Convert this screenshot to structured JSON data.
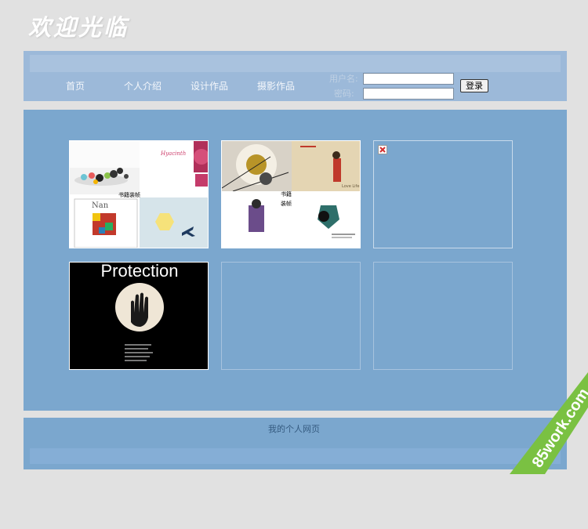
{
  "header": {
    "welcome": "欢迎光临"
  },
  "nav": {
    "items": [
      {
        "label": "首页"
      },
      {
        "label": "个人介绍"
      },
      {
        "label": "设计作品"
      },
      {
        "label": "摄影作品"
      }
    ]
  },
  "login": {
    "username_label": "用户名:",
    "password_label": "密码:",
    "username_value": "",
    "password_value": "",
    "button_label": "登录"
  },
  "gallery": {
    "card1": {
      "caption": "书籍装帧",
      "title": "Hyacinth",
      "name": "Nan"
    },
    "card2": {
      "caption": "书籍装帧",
      "side": "Love Life"
    },
    "card4": {
      "title": "Protection"
    }
  },
  "footer": {
    "text": "我的个人网页"
  },
  "watermark": {
    "text": "85work.com"
  },
  "colors": {
    "page_bg": "#e1e1e1",
    "header_bg": "#9cb9d9",
    "main_bg": "#7ba7ce",
    "watermark_green": "#7ac142"
  }
}
